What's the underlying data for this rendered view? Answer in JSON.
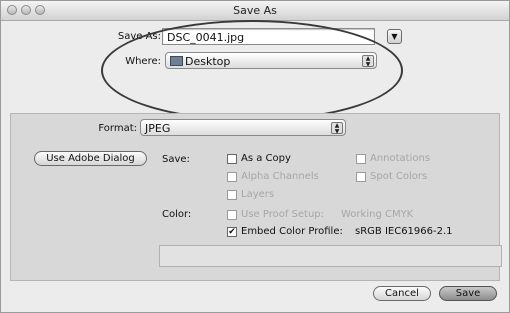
{
  "window": {
    "title": "Save As"
  },
  "save_as": {
    "label": "Save As:",
    "value": "DSC_0041.jpg"
  },
  "where": {
    "label": "Where:",
    "value": "Desktop",
    "icon": "folder-icon"
  },
  "format": {
    "label": "Format:",
    "value": "JPEG"
  },
  "adobe_dialog_label": "Use Adobe Dialog",
  "save_options": {
    "label": "Save:",
    "as_a_copy": {
      "label": "As a Copy",
      "checked": false,
      "enabled": true
    },
    "annotations": {
      "label": "Annotations",
      "checked": false,
      "enabled": false
    },
    "alpha_channels": {
      "label": "Alpha Channels",
      "checked": false,
      "enabled": false
    },
    "spot_colors": {
      "label": "Spot Colors",
      "checked": false,
      "enabled": false
    },
    "layers": {
      "label": "Layers",
      "checked": false,
      "enabled": false
    }
  },
  "color": {
    "label": "Color:",
    "use_proof_setup": {
      "label": "Use Proof Setup:",
      "value": "Working CMYK",
      "checked": false,
      "enabled": false
    },
    "embed_color_profile": {
      "label": "Embed Color Profile:",
      "value": "sRGB IEC61966-2.1",
      "checked": true,
      "enabled": true
    }
  },
  "buttons": {
    "cancel": "Cancel",
    "save": "Save"
  }
}
